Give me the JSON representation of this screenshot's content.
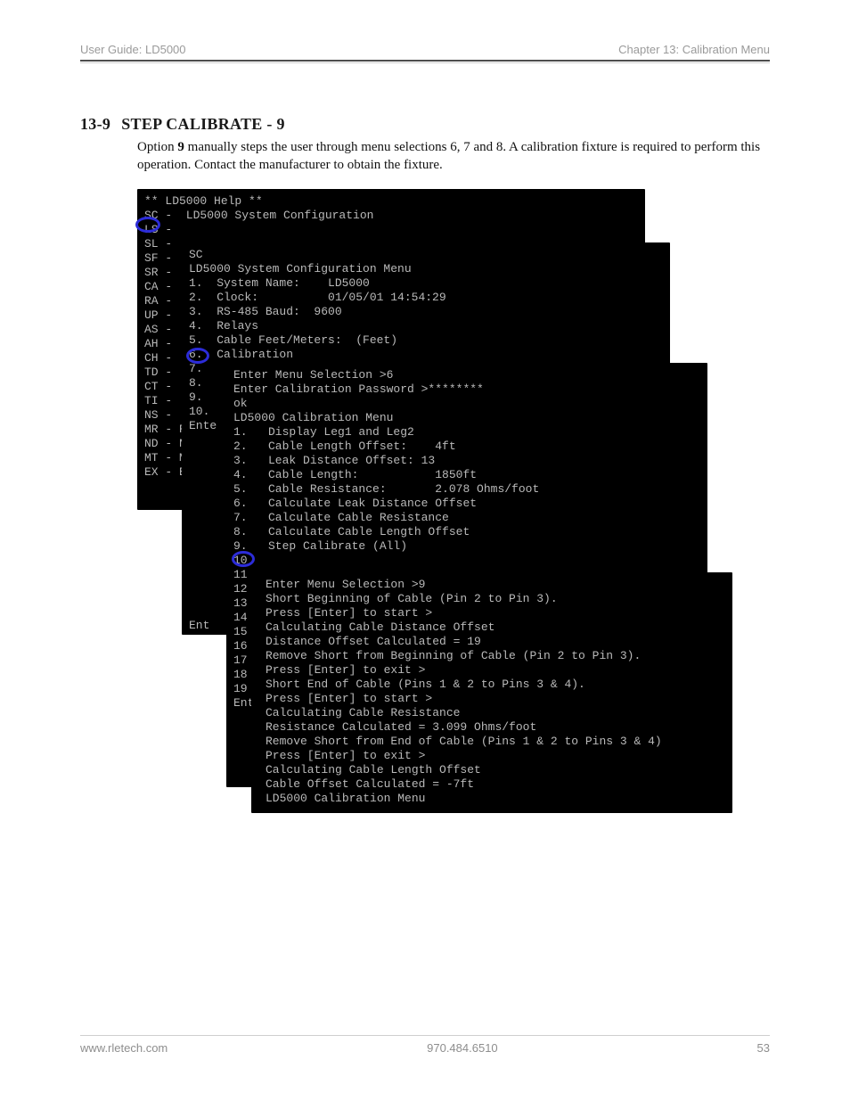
{
  "header": {
    "left": "User Guide: LD5000",
    "right": "Chapter 13: Calibration Menu"
  },
  "section": {
    "num": "13-9",
    "title": "STEP CALIBRATE - 9"
  },
  "para": {
    "prefix": "Option ",
    "bold": "9",
    "rest": " manually steps the user through menu selections 6, 7 and 8.  A calibration fixture is required to perform this operation.  Contact the manufacturer to obtain the fixture."
  },
  "layer1": "** LD5000 Help **\nSC -  LD5000 System Configuration\nLS -\nSL -\nSF -\nSR -\nCA -\nRA -\nUP -\nAS -\nAH -\nCH -\nTD -\nCT -\nTI -\nNS -\nMR - Reset\nND - Netwo\nMT - Modbu\nEX - Exit",
  "layer2": "SC\nLD5000 System Configuration Menu\n1.  System Name:    LD5000\n2.  Clock:          01/05/01 14:54:29\n3.  RS-485 Baud:  9600\n4.  Relays\n5.  Cable Feet/Meters:  (Feet)\n6.  Calibration\n7.\n8.\n9.\n10.\nEnte\n\n\n\n\n\n\n\n\n\n\n\n\n\nEnt",
  "layer3": "Enter Menu Selection >6\nEnter Calibration Password >********\nok\nLD5000 Calibration Menu\n1.   Display Leg1 and Leg2\n2.   Cable Length Offset:    4ft\n3.   Leak Distance Offset: 13\n4.   Cable Length:           1850ft\n5.   Cable Resistance:       2.078 Ohms/foot\n6.   Calculate Leak Distance Offset\n7.   Calculate Cable Resistance\n8.   Calculate Cable Length Offset\n9.   Step Calibrate (All)\n10\n11\n12\n13\n14\n15\n16\n17\n18\n19\nEnt",
  "layer4": "Enter Menu Selection >9\nShort Beginning of Cable (Pin 2 to Pin 3).\nPress [Enter] to start >\nCalculating Cable Distance Offset\nDistance Offset Calculated = 19\nRemove Short from Beginning of Cable (Pin 2 to Pin 3).\nPress [Enter] to exit >\nShort End of Cable (Pins 1 & 2 to Pins 3 & 4).\nPress [Enter] to start >\nCalculating Cable Resistance\nResistance Calculated = 3.099 Ohms/foot\nRemove Short from End of Cable (Pins 1 & 2 to Pins 3 & 4)\nPress [Enter] to exit >\nCalculating Cable Length Offset\nCable Offset Calculated = -7ft\nLD5000 Calibration Menu",
  "footer": {
    "left": "www.rletech.com",
    "center": "970.484.6510",
    "right": "53"
  }
}
